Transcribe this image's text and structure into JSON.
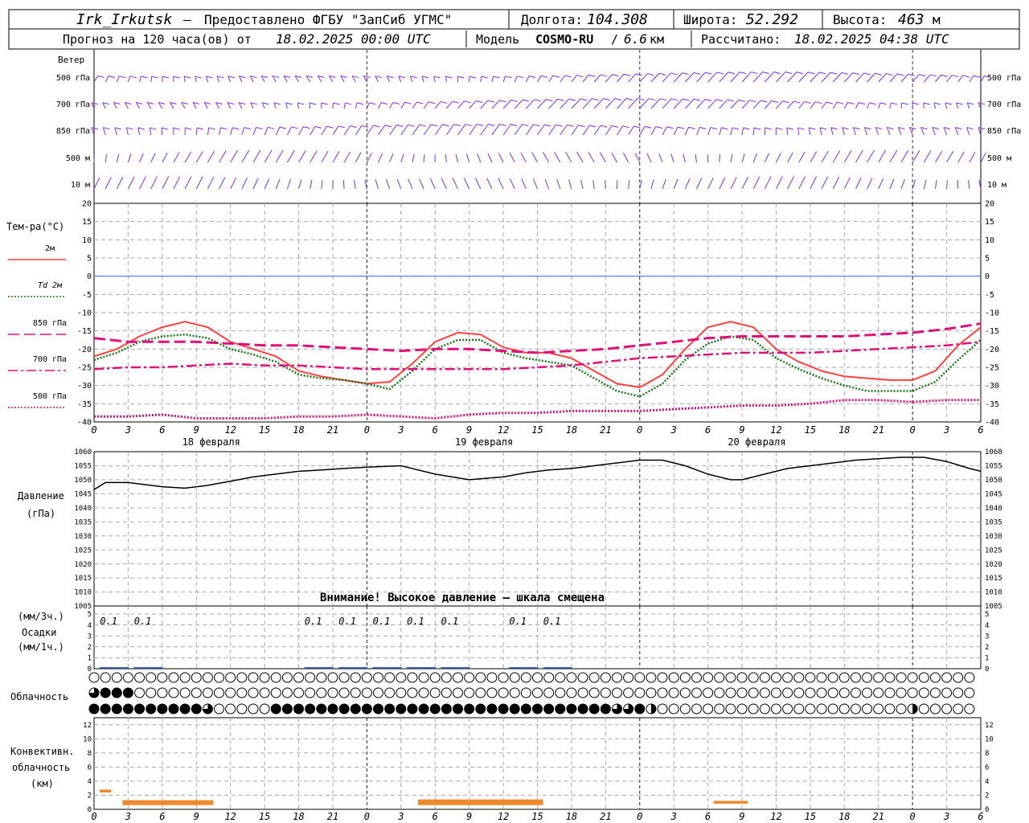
{
  "header": {
    "station": "Irk_Irkutsk",
    "dash": "–",
    "provider": "Предоставлено ФГБУ \"ЗапСиб УГМС\"",
    "lon_label": "Долгота:",
    "lon_value": "104.308",
    "lat_label": "Широта:",
    "lat_value": "52.292",
    "alt_label": "Высота:",
    "alt_value": "463",
    "alt_unit": "м",
    "forecast_text": "Прогноз на 120 часа(ов) от",
    "forecast_start": "18.02.2025 00:00 UTC",
    "model_label": "Модель",
    "model_name": "COSMO-RU",
    "model_res": "6.6",
    "model_res_unit": "км",
    "computed_label": "Рассчитано:",
    "computed_time": "18.02.2025 04:38 UTC"
  },
  "labels": {
    "wind": "Ветер",
    "temperature": "Тем-ра(°С)",
    "pressure": "Давление",
    "pressure_unit": "(гПа)",
    "precip_unit3": "(мм/3ч.)",
    "precip": "Осадки",
    "precip_unit1": "(мм/1ч.)",
    "cloudiness": "Облачность",
    "conv1": "Конвективн.",
    "conv2": "облачность",
    "conv_unit": "(км)",
    "pressure_warning": "Внимание! Высокое давление – шкала смещена"
  },
  "wind_levels": [
    "500 гПа",
    "700 гПа",
    "850 гПа",
    "500 м",
    "10 м"
  ],
  "temp_legend": [
    {
      "label": "2м",
      "color": "#ff4040",
      "style": "solid"
    },
    {
      "label": "Td 2м",
      "color": "#1a7a1a",
      "style": "dotted"
    },
    {
      "label": "850 гПа",
      "color": "#e0107a",
      "style": "dash"
    },
    {
      "label": "700 гПа",
      "color": "#e0107a",
      "style": "dashdot"
    },
    {
      "label": "500 гПа",
      "color": "#e0107a",
      "style": "dotted"
    }
  ],
  "time_axis": {
    "hour_labels": [
      "0",
      "3",
      "6",
      "9",
      "12",
      "15",
      "18",
      "21",
      "0",
      "3",
      "6",
      "9",
      "12",
      "15",
      "18",
      "21",
      "0",
      "3",
      "6",
      "9",
      "12",
      "15",
      "18",
      "21",
      "0",
      "3",
      "6"
    ],
    "days": [
      {
        "label": "18 февраля",
        "center_hour": 12
      },
      {
        "label": "19 февраля",
        "center_hour": 36
      },
      {
        "label": "20 февраля",
        "center_hour": 60
      }
    ]
  },
  "chart_data": [
    {
      "type": "line",
      "title": "Тем-ра(°С)",
      "x_unit": "hours since 18.02.2025 00:00 UTC",
      "xlim": [
        0,
        78
      ],
      "ylim": [
        -40,
        20
      ],
      "yticks": [
        -40,
        -35,
        -30,
        -25,
        -20,
        -15,
        -10,
        -5,
        0,
        5,
        10,
        15,
        20
      ],
      "zero_line_color": "#3b6cff",
      "series": [
        {
          "name": "2м",
          "color": "#ff4040",
          "x": [
            0,
            2,
            4,
            6,
            8,
            10,
            12,
            14,
            16,
            18,
            20,
            22,
            24,
            26,
            28,
            30,
            32,
            34,
            36,
            38,
            40,
            42,
            44,
            46,
            48,
            50,
            52,
            54,
            56,
            58,
            60,
            62,
            64,
            66,
            68,
            70,
            72,
            74,
            76,
            78
          ],
          "y": [
            -22,
            -20,
            -16.5,
            -14,
            -12.5,
            -14,
            -18,
            -20,
            -22,
            -26,
            -27.5,
            -28.5,
            -29.5,
            -29,
            -24,
            -18,
            -15.5,
            -16,
            -19.5,
            -21,
            -21,
            -22.5,
            -26,
            -29.5,
            -30.5,
            -27,
            -20,
            -14,
            -12.5,
            -14,
            -20,
            -23.5,
            -26,
            -27.5,
            -28,
            -28.5,
            -28.5,
            -26,
            -19,
            -14
          ]
        },
        {
          "name": "Td 2м",
          "color": "#1a7a1a",
          "x": [
            0,
            2,
            4,
            6,
            8,
            10,
            12,
            14,
            16,
            18,
            20,
            22,
            24,
            26,
            28,
            30,
            32,
            34,
            36,
            38,
            40,
            42,
            44,
            46,
            48,
            50,
            52,
            54,
            56,
            58,
            60,
            62,
            64,
            66,
            68,
            70,
            72,
            74,
            76,
            78
          ],
          "y": [
            -23,
            -21,
            -18,
            -16.5,
            -16,
            -17,
            -20,
            -21.5,
            -23.5,
            -27,
            -28,
            -28.5,
            -29.5,
            -31,
            -26,
            -20,
            -17.5,
            -17.5,
            -21,
            -22.5,
            -23.5,
            -24.5,
            -28,
            -31.5,
            -33,
            -29.5,
            -23,
            -18.5,
            -16.5,
            -17.5,
            -22.5,
            -25.5,
            -28,
            -30,
            -31.5,
            -31.5,
            -31.5,
            -29,
            -23,
            -17.5
          ]
        },
        {
          "name": "850 гПа",
          "color": "#e0107a",
          "x": [
            0,
            3,
            6,
            9,
            12,
            15,
            18,
            21,
            24,
            27,
            30,
            33,
            36,
            39,
            42,
            45,
            48,
            51,
            54,
            57,
            60,
            63,
            66,
            69,
            72,
            75,
            78
          ],
          "y": [
            -17,
            -18,
            -18,
            -18,
            -18.5,
            -19,
            -19,
            -19.5,
            -20,
            -20.5,
            -20,
            -20,
            -20.5,
            -21,
            -20.5,
            -20,
            -19,
            -18,
            -17,
            -16.5,
            -16.5,
            -16.5,
            -16.5,
            -16,
            -15.5,
            -14.5,
            -13
          ]
        },
        {
          "name": "700 гПа",
          "color": "#e0107a",
          "x": [
            0,
            3,
            6,
            9,
            12,
            15,
            18,
            21,
            24,
            27,
            30,
            33,
            36,
            39,
            42,
            45,
            48,
            51,
            54,
            57,
            60,
            63,
            66,
            69,
            72,
            75,
            78
          ],
          "y": [
            -25.5,
            -25,
            -25,
            -24.5,
            -24,
            -24.5,
            -24.5,
            -25,
            -25.5,
            -25.5,
            -25.5,
            -25.5,
            -25.5,
            -25,
            -24.5,
            -23.5,
            -22.5,
            -22,
            -21.5,
            -21,
            -21,
            -21,
            -20.5,
            -20,
            -19.5,
            -19,
            -18
          ]
        },
        {
          "name": "500 гПа",
          "color": "#e0107a",
          "x": [
            0,
            3,
            6,
            9,
            12,
            15,
            18,
            21,
            24,
            27,
            30,
            33,
            36,
            39,
            42,
            45,
            48,
            51,
            54,
            57,
            60,
            63,
            66,
            69,
            72,
            75,
            78
          ],
          "y": [
            -38.5,
            -38.5,
            -38,
            -39,
            -39,
            -39,
            -38.5,
            -38.5,
            -38,
            -38.5,
            -39,
            -38,
            -37.5,
            -37.5,
            -37,
            -37,
            -37,
            -36.5,
            -36,
            -35.5,
            -35.5,
            -35,
            -34,
            -34,
            -34.5,
            -34,
            -34
          ]
        }
      ]
    },
    {
      "type": "line",
      "title": "Давление",
      "ylabel": "(гПа)",
      "xlim": [
        0,
        78
      ],
      "ylim": [
        1005,
        1060
      ],
      "yticks": [
        1005,
        1010,
        1015,
        1020,
        1025,
        1030,
        1035,
        1040,
        1045,
        1050,
        1055,
        1060
      ],
      "series": [
        {
          "color": "#000000",
          "x": [
            0,
            1,
            3,
            6,
            8,
            10,
            12,
            14,
            16,
            18,
            20,
            22,
            24,
            27,
            30,
            33,
            36,
            38,
            40,
            42,
            44,
            46,
            48,
            50,
            52,
            54,
            56,
            57,
            59,
            61,
            63,
            65,
            67,
            69,
            71,
            73,
            75,
            77,
            78
          ],
          "y": [
            1046.5,
            1049,
            1049,
            1047.5,
            1047,
            1048,
            1049.5,
            1051,
            1052,
            1053,
            1053.5,
            1054,
            1054.5,
            1055,
            1052,
            1050,
            1051,
            1052.5,
            1053.5,
            1054,
            1055,
            1056,
            1057,
            1057,
            1055,
            1052,
            1050,
            1050,
            1052,
            1054,
            1055,
            1056,
            1057,
            1057.5,
            1058,
            1058,
            1056.5,
            1054,
            1053
          ]
        }
      ]
    },
    {
      "type": "bar",
      "title": "Осадки",
      "ylabel": "(мм/3ч.) (мм/1ч.)",
      "ylim": [
        0,
        5
      ],
      "yticks": [
        0,
        1,
        2,
        3,
        4,
        5
      ],
      "x": [
        1,
        4,
        19,
        22,
        25,
        28,
        31,
        37,
        40
      ],
      "values": [
        0.1,
        0.1,
        0.1,
        0.1,
        0.1,
        0.1,
        0.1,
        0.1,
        0.1
      ],
      "value_labels": [
        "0.1",
        "0.1",
        "0.1",
        "0.1",
        "0.1",
        "0.1",
        "0.1",
        "0.1",
        "0.1"
      ]
    },
    {
      "type": "bar",
      "title": "Конвективн. облачность",
      "ylabel": "(км)",
      "ylim": [
        0,
        13
      ],
      "yticks": [
        0,
        2,
        4,
        6,
        8,
        10,
        12
      ],
      "segments": [
        {
          "x0": 0.5,
          "x1": 1.5,
          "bottom": 2.4,
          "top": 2.8
        },
        {
          "x0": 2.5,
          "x1": 10.5,
          "bottom": 0.6,
          "top": 1.3
        },
        {
          "x0": 28.5,
          "x1": 39.5,
          "bottom": 0.6,
          "top": 1.4
        },
        {
          "x0": 54.5,
          "x1": 57.5,
          "bottom": 0.8,
          "top": 1.2
        }
      ],
      "color": "#ee8a2e"
    }
  ],
  "cloud_rows": {
    "row1": "000000000000000000000000000000000000000000000000000000000000000000000000000000",
    "row2": "344400000000000000000000000000000000000000000000000000000000000000000000000000",
    "row3": "444444444430000044444444444444444444444444444433420000000000000000000000200000"
  }
}
